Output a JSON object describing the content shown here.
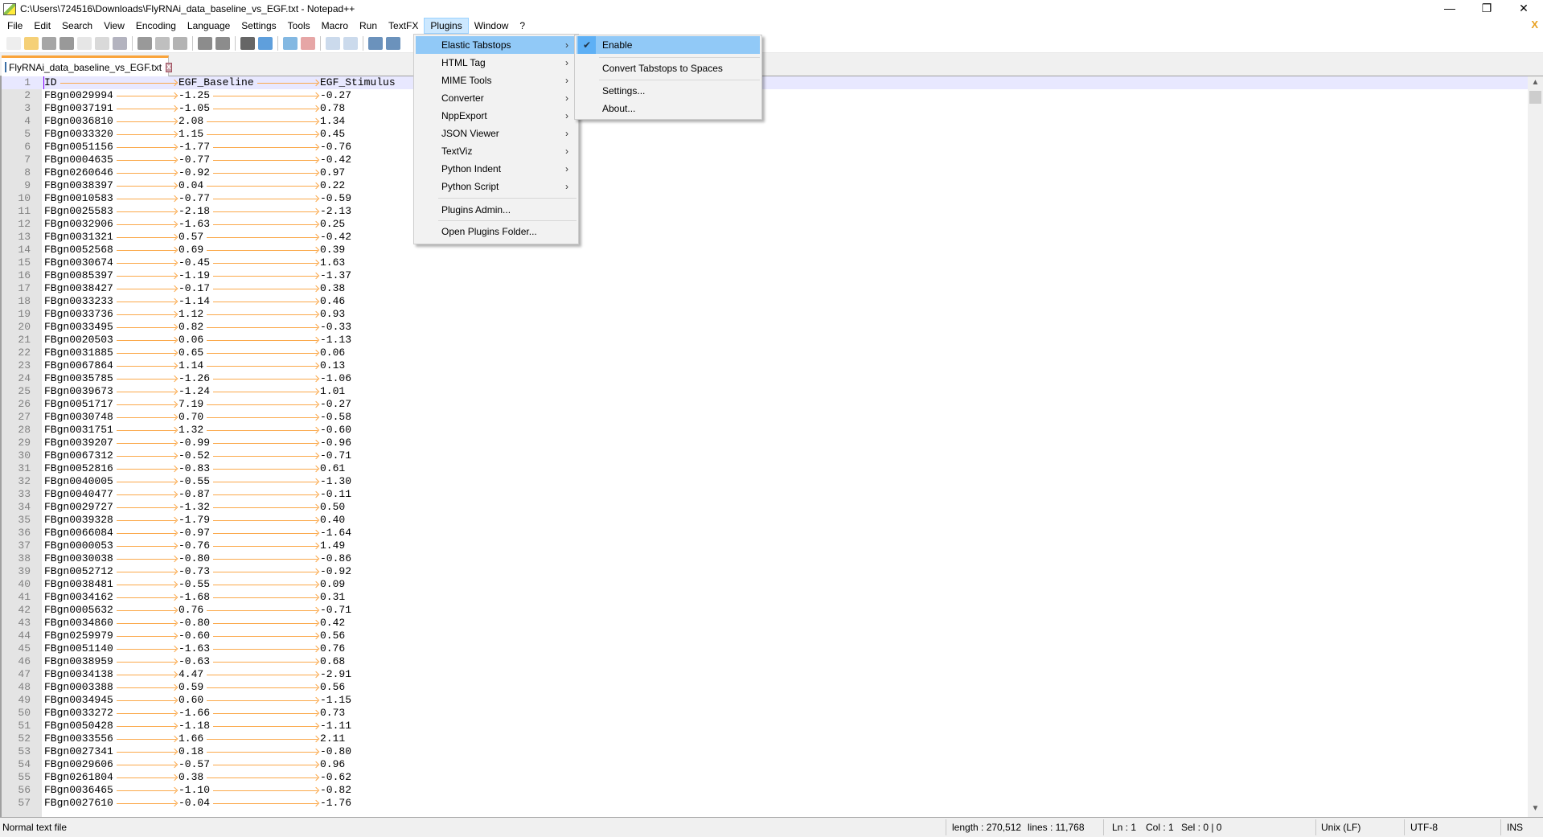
{
  "window": {
    "title": "C:\\Users\\724516\\Downloads\\FlyRNAi_data_baseline_vs_EGF.txt - Notepad++",
    "minimize": "—",
    "restore": "❐",
    "close": "✕",
    "doc_close": "X"
  },
  "menubar": [
    "File",
    "Edit",
    "Search",
    "View",
    "Encoding",
    "Language",
    "Settings",
    "Tools",
    "Macro",
    "Run",
    "TextFX",
    "Plugins",
    "Window",
    "?"
  ],
  "toolbar": [
    "new-file",
    "open-file",
    "save",
    "save-all",
    "close",
    "close-all",
    "print",
    "cut",
    "copy",
    "paste",
    "undo",
    "redo",
    "find",
    "replace",
    "zoom-in",
    "zoom-out",
    "sync-vertical",
    "sync-horizontal",
    "word-wrap",
    "show-all-chars"
  ],
  "tab": {
    "label": "FlyRNAi_data_baseline_vs_EGF.txt",
    "close": "x"
  },
  "accent": {
    "tab_top": "#faa43a",
    "tab_arrow": "#fba94b",
    "menu_highlight": "#91c9f7",
    "current_line": "#e8e8ff"
  },
  "plugins_menu": {
    "items": [
      {
        "label": "Elastic Tabstops",
        "submenu": true,
        "highlighted": true
      },
      {
        "label": "HTML Tag",
        "submenu": true
      },
      {
        "label": "MIME Tools",
        "submenu": true
      },
      {
        "label": "Converter",
        "submenu": true
      },
      {
        "label": "NppExport",
        "submenu": true
      },
      {
        "label": "JSON Viewer",
        "submenu": true
      },
      {
        "label": "TextViz",
        "submenu": true
      },
      {
        "label": "Python Indent",
        "submenu": true
      },
      {
        "label": "Python Script",
        "submenu": true
      },
      {
        "label": "Plugins Admin..."
      },
      {
        "label": "Open Plugins Folder..."
      }
    ]
  },
  "elastic_submenu": {
    "items": [
      {
        "label": "Enable",
        "checked": true
      },
      {
        "label": "Convert Tabstops to Spaces"
      },
      {
        "label": "Settings..."
      },
      {
        "label": "About..."
      }
    ]
  },
  "lines": [
    [
      "ID",
      "EGF_Baseline",
      "EGF_Stimulus"
    ],
    [
      "FBgn0029994",
      "-1.25",
      "-0.27"
    ],
    [
      "FBgn0037191",
      "-1.05",
      "0.78"
    ],
    [
      "FBgn0036810",
      "2.08",
      "1.34"
    ],
    [
      "FBgn0033320",
      "1.15",
      "0.45"
    ],
    [
      "FBgn0051156",
      "-1.77",
      "-0.76"
    ],
    [
      "FBgn0004635",
      "-0.77",
      "-0.42"
    ],
    [
      "FBgn0260646",
      "-0.92",
      "0.97"
    ],
    [
      "FBgn0038397",
      "0.04",
      "0.22"
    ],
    [
      "FBgn0010583",
      "-0.77",
      "-0.59"
    ],
    [
      "FBgn0025583",
      "-2.18",
      "-2.13"
    ],
    [
      "FBgn0032906",
      "-1.63",
      "0.25"
    ],
    [
      "FBgn0031321",
      "0.57",
      "-0.42"
    ],
    [
      "FBgn0052568",
      "0.69",
      "0.39"
    ],
    [
      "FBgn0030674",
      "-0.45",
      "1.63"
    ],
    [
      "FBgn0085397",
      "-1.19",
      "-1.37"
    ],
    [
      "FBgn0038427",
      "-0.17",
      "0.38"
    ],
    [
      "FBgn0033233",
      "-1.14",
      "0.46"
    ],
    [
      "FBgn0033736",
      "1.12",
      "0.93"
    ],
    [
      "FBgn0033495",
      "0.82",
      "-0.33"
    ],
    [
      "FBgn0020503",
      "0.06",
      "-1.13"
    ],
    [
      "FBgn0031885",
      "0.65",
      "0.06"
    ],
    [
      "FBgn0067864",
      "1.14",
      "0.13"
    ],
    [
      "FBgn0035785",
      "-1.26",
      "-1.06"
    ],
    [
      "FBgn0039673",
      "-1.24",
      "1.01"
    ],
    [
      "FBgn0051717",
      "7.19",
      "-0.27"
    ],
    [
      "FBgn0030748",
      "0.70",
      "-0.58"
    ],
    [
      "FBgn0031751",
      "1.32",
      "-0.60"
    ],
    [
      "FBgn0039207",
      "-0.99",
      "-0.96"
    ],
    [
      "FBgn0067312",
      "-0.52",
      "-0.71"
    ],
    [
      "FBgn0052816",
      "-0.83",
      "0.61"
    ],
    [
      "FBgn0040005",
      "-0.55",
      "-1.30"
    ],
    [
      "FBgn0040477",
      "-0.87",
      "-0.11"
    ],
    [
      "FBgn0029727",
      "-1.32",
      "0.50"
    ],
    [
      "FBgn0039328",
      "-1.79",
      "0.40"
    ],
    [
      "FBgn0066084",
      "-0.97",
      "-1.64"
    ],
    [
      "FBgn0000053",
      "-0.76",
      "1.49"
    ],
    [
      "FBgn0030038",
      "-0.80",
      "-0.86"
    ],
    [
      "FBgn0052712",
      "-0.73",
      "-0.92"
    ],
    [
      "FBgn0038481",
      "-0.55",
      "0.09"
    ],
    [
      "FBgn0034162",
      "-1.68",
      "0.31"
    ],
    [
      "FBgn0005632",
      "0.76",
      "-0.71"
    ],
    [
      "FBgn0034860",
      "-0.80",
      "0.42"
    ],
    [
      "FBgn0259979",
      "-0.60",
      "0.56"
    ],
    [
      "FBgn0051140",
      "-1.63",
      "0.76"
    ],
    [
      "FBgn0038959",
      "-0.63",
      "0.68"
    ],
    [
      "FBgn0034138",
      "4.47",
      "-2.91"
    ],
    [
      "FBgn0003388",
      "0.59",
      "0.56"
    ],
    [
      "FBgn0034945",
      "0.60",
      "-1.15"
    ],
    [
      "FBgn0033272",
      "-1.66",
      "0.73"
    ],
    [
      "FBgn0050428",
      "-1.18",
      "-1.11"
    ],
    [
      "FBgn0033556",
      "1.66",
      "2.11"
    ],
    [
      "FBgn0027341",
      "0.18",
      "-0.80"
    ],
    [
      "FBgn0029606",
      "-0.57",
      "0.96"
    ],
    [
      "FBgn0261804",
      "0.38",
      "-0.62"
    ],
    [
      "FBgn0036465",
      "-1.10",
      "-0.82"
    ],
    [
      "FBgn0027610",
      "-0.04",
      "-1.76"
    ]
  ],
  "statusbar": {
    "file_type": "Normal text file",
    "length": "length : 270,512",
    "lines": "lines : 11,768",
    "ln": "Ln : 1",
    "col": "Col : 1",
    "sel": "Sel : 0 | 0",
    "eol": "Unix (LF)",
    "encoding": "UTF-8",
    "mode": "INS"
  }
}
